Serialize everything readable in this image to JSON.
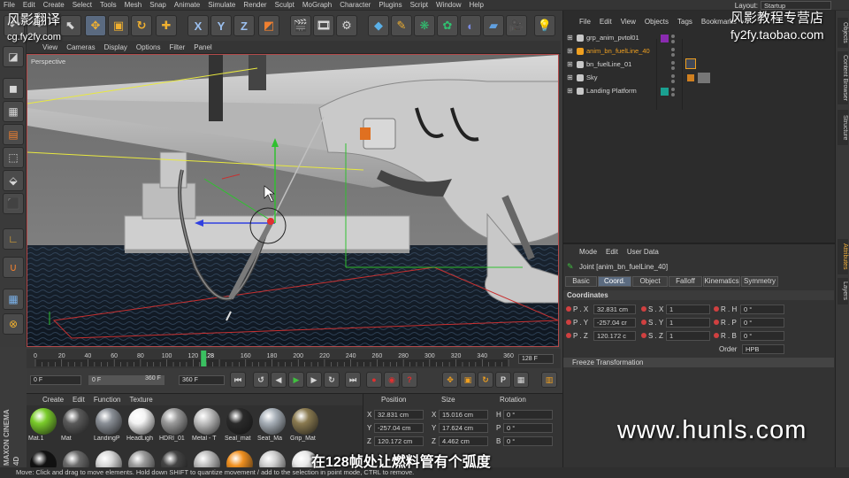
{
  "menubar": {
    "items": [
      "File",
      "Edit",
      "Create",
      "Select",
      "Tools",
      "Mesh",
      "Snap",
      "Animate",
      "Simulate",
      "Render",
      "Sculpt",
      "MoGraph",
      "Character",
      "Plugins",
      "Script",
      "Window",
      "Help"
    ],
    "layout_label": "Layout:",
    "layout_value": "Startup"
  },
  "watermarks": {
    "cn_left": "风影翻译",
    "url_left": "cg.fy2fy.com",
    "cn_right": "风影教程专营店",
    "url_right": "fy2fy.taobao.com",
    "hunls": "www.hunls.com",
    "subtitle": "在128帧处让燃料管有个弧度"
  },
  "toolbar": {
    "axis_x": "X",
    "axis_y": "Y",
    "axis_z": "Z"
  },
  "viewport": {
    "menu": [
      "View",
      "Cameras",
      "Display",
      "Options",
      "Filter",
      "Panel"
    ],
    "label": "Perspective"
  },
  "timeline": {
    "ticks": [
      "0",
      "20",
      "40",
      "60",
      "80",
      "100",
      "120",
      "128",
      "160",
      "180",
      "200",
      "220",
      "240",
      "260",
      "280",
      "300",
      "320",
      "340",
      "360"
    ],
    "current_frame_field": "128 F",
    "current_frame": 128,
    "max_frame": 360
  },
  "transport": {
    "start_field": "0 F",
    "min_field": "0 F",
    "max_field": "360 F",
    "end_field": "360 F"
  },
  "materials": {
    "menu": [
      "Create",
      "Edit",
      "Function",
      "Texture"
    ],
    "items": [
      {
        "label": "Mat.1",
        "color": "#7acc2a"
      },
      {
        "label": "Mat",
        "color": "#5a5a5a"
      },
      {
        "label": "LandingP",
        "color": "#8a8f96"
      },
      {
        "label": "HeadLigh",
        "color": "#f4f4f4"
      },
      {
        "label": "HDRI_01",
        "color": "#9a9a9a"
      },
      {
        "label": "Metal - T",
        "color": "#c0c0c0"
      },
      {
        "label": "Seal_mat",
        "color": "#2a2a2a"
      },
      {
        "label": "Seat_Ma",
        "color": "#a8b0b8"
      },
      {
        "label": "Grip_Mat",
        "color": "#8a7a50"
      }
    ],
    "row2_colors": [
      "#111111",
      "#6a6a6a",
      "#d8d8d8",
      "#9a9a9a",
      "#444444",
      "#bdbdbd",
      "#f09020",
      "#cfcfcf",
      "#e8e8e8"
    ],
    "brand": "MAXON CINEMA 4D"
  },
  "coordinates": {
    "headers": [
      "Position",
      "Size",
      "Rotation"
    ],
    "rows": [
      {
        "axis": "X",
        "pos": "32.831 cm",
        "size_axis": "X",
        "size": "15.016 cm",
        "rot_axis": "H",
        "rot": "0 °"
      },
      {
        "axis": "Y",
        "pos": "-257.04 cm",
        "size_axis": "Y",
        "size": "17.624 cm",
        "rot_axis": "P",
        "rot": "0 °"
      },
      {
        "axis": "Z",
        "pos": "120.172 cm",
        "size_axis": "Z",
        "size": "4.462 cm",
        "rot_axis": "B",
        "rot": "0 °"
      }
    ]
  },
  "objects": {
    "menu": [
      "File",
      "Edit",
      "View",
      "Objects",
      "Tags",
      "Bookmarks"
    ],
    "rows": [
      {
        "name": "grp_anim_pvtol01",
        "color": "#c8c8c8",
        "tag": "#8a2bb0"
      },
      {
        "name": "anim_bn_fuelLine_40",
        "color": "#f0a020",
        "tag": ""
      },
      {
        "name": "bn_fuelLine_01",
        "color": "#c8c8c8",
        "tag": ""
      },
      {
        "name": "Sky",
        "color": "#c8c8c8",
        "tag": ""
      },
      {
        "name": "Landing Platform",
        "color": "#c8c8c8",
        "tag": "#1aa090"
      }
    ]
  },
  "attributes": {
    "menu": [
      "Mode",
      "Edit",
      "User Data"
    ],
    "title": "Joint [anim_bn_fuelLine_40]",
    "tabs": [
      "Basic",
      "Coord.",
      "Object",
      "Falloff",
      "Kinematics",
      "Symmetry"
    ],
    "active_tab": "Coord.",
    "section": "Coordinates",
    "rows": [
      {
        "p": "P . X",
        "pv": "32.831 cm",
        "s": "S . X",
        "sv": "1",
        "r": "R . H",
        "rv": "0 °"
      },
      {
        "p": "P . Y",
        "pv": "-257.04 cr",
        "s": "S . Y",
        "sv": "1",
        "r": "R . P",
        "rv": "0 °"
      },
      {
        "p": "P . Z",
        "pv": "120.172 c",
        "s": "S . Z",
        "sv": "1",
        "r": "R . B",
        "rv": "0 °"
      }
    ],
    "order_label": "Order",
    "order_value": "HPB",
    "freeze": "Freeze Transformation"
  },
  "side_tabs": [
    "Objects",
    "Content Browser",
    "Structure",
    "Attributes",
    "Layers"
  ],
  "status": "Move: Click and drag to move elements. Hold down SHIFT to quantize movement / add to the selection in point mode, CTRL to remove."
}
